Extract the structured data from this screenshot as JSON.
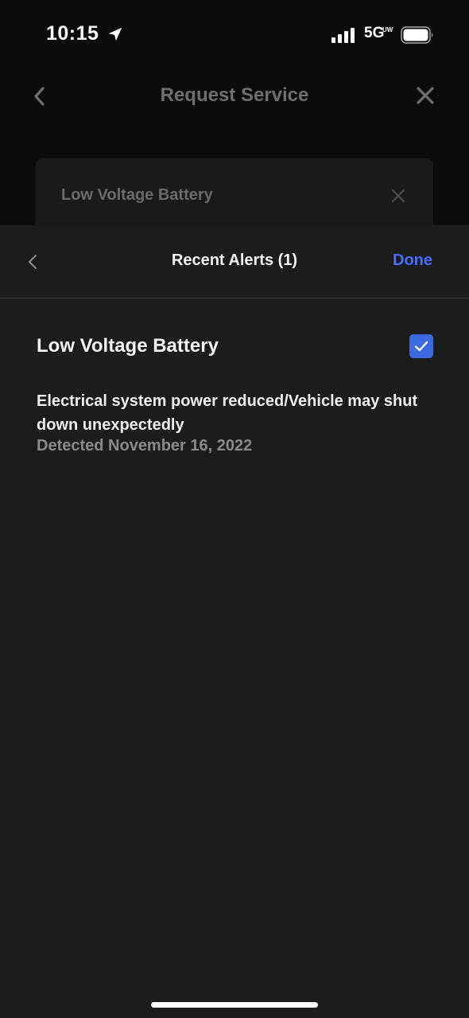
{
  "status_bar": {
    "time": "10:15",
    "network": "5G",
    "network_suffix": "UW",
    "icons": [
      "location-arrow-icon",
      "signal-bars-icon",
      "battery-icon"
    ]
  },
  "background_page": {
    "title": "Request Service",
    "card_label": "Low Voltage Battery",
    "icons": [
      "chevron-left-icon",
      "close-icon"
    ]
  },
  "sheet": {
    "title": "Recent Alerts (1)",
    "done_label": "Done",
    "accent_color": "#4a6cf7",
    "alert": {
      "title": "Low Voltage Battery",
      "description": "Electrical system power reduced/Vehicle may shut down unexpectedly",
      "detected": "Detected November 16, 2022",
      "checked": true
    }
  }
}
